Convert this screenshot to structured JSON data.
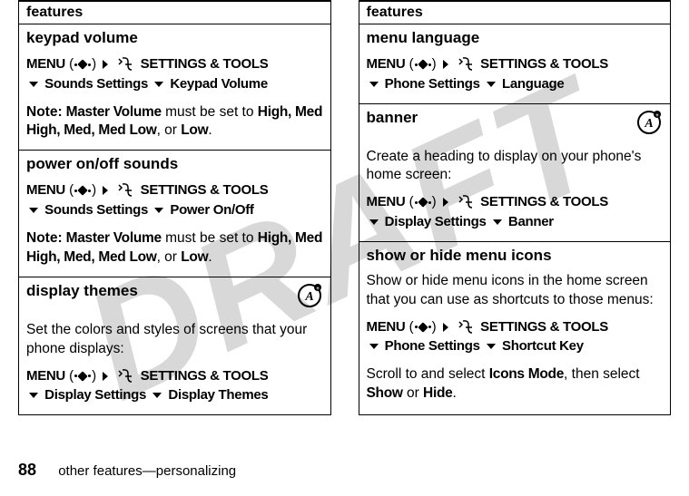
{
  "draft": "DRAFT",
  "left": {
    "header": "features",
    "sections": [
      {
        "title": "keypad volume",
        "menu": "MENU",
        "settings": "SETTINGS & TOOLS",
        "sub1": "Sounds Settings",
        "sub2": "Keypad Volume",
        "note_label": "Note:",
        "note_pre": " Master Volume",
        "note_mid": " must be set to ",
        "note_vals": "High, Med High, Med, Med Low",
        "note_or": ", or ",
        "note_last": "Low",
        "note_end": "."
      },
      {
        "title": "power on/off sounds",
        "menu": "MENU",
        "settings": "SETTINGS & TOOLS",
        "sub1": "Sounds Settings",
        "sub2": "Power On/Off",
        "note_label": "Note:",
        "note_pre": " Master Volume",
        "note_mid": " must be set to ",
        "note_vals": "High, Med High, Med, Med Low",
        "note_or": ", or ",
        "note_last": "Low",
        "note_end": "."
      },
      {
        "title": "display themes",
        "desc": "Set the colors and styles of screens that your phone displays:",
        "menu": "MENU",
        "settings": "SETTINGS & TOOLS",
        "sub1": "Display Settings",
        "sub2": "Display Themes"
      }
    ]
  },
  "right": {
    "header": "features",
    "sections": [
      {
        "title": "menu language",
        "menu": "MENU",
        "settings": "SETTINGS & TOOLS",
        "sub1": "Phone Settings",
        "sub2": "Language"
      },
      {
        "title": "banner",
        "desc": "Create a heading to display on your phone's home screen:",
        "menu": "MENU",
        "settings": "SETTINGS & TOOLS",
        "sub1": "Display Settings",
        "sub2": "Banner"
      },
      {
        "title": "show or hide menu icons",
        "desc": "Show or hide menu icons in the home screen that you can use as shortcuts to those menus:",
        "menu": "MENU",
        "settings": "SETTINGS & TOOLS",
        "sub1": "Phone Settings",
        "sub2": "Shortcut Key",
        "extra_pre": "Scroll to and select ",
        "extra_b1": "Icons Mode",
        "extra_mid": ", then select ",
        "extra_b2": "Show",
        "extra_or": " or ",
        "extra_b3": "Hide",
        "extra_end": "."
      }
    ]
  },
  "footer": {
    "page": "88",
    "text": "other features—personalizing"
  }
}
